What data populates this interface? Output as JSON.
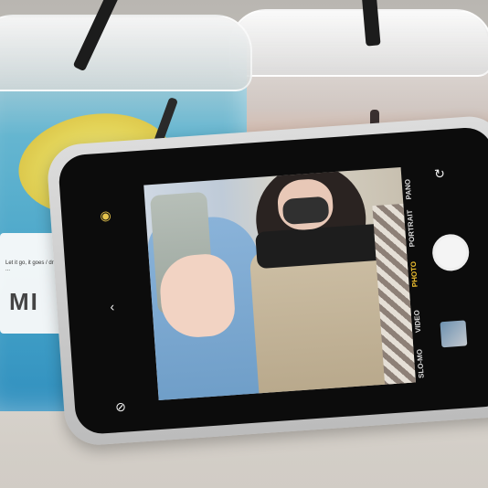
{
  "cup_label": {
    "brand": "MI",
    "small_text": "Let it go, it goes / drink it ..."
  },
  "camera": {
    "modes": [
      "SLO-MO",
      "VIDEO",
      "PHOTO",
      "PORTRAIT",
      "PANO"
    ],
    "active_mode": "PHOTO"
  },
  "colors": {
    "accent_yellow": "#f2c230",
    "drink_blue": "#3ea6d0",
    "lemon": "#f0d64a"
  }
}
